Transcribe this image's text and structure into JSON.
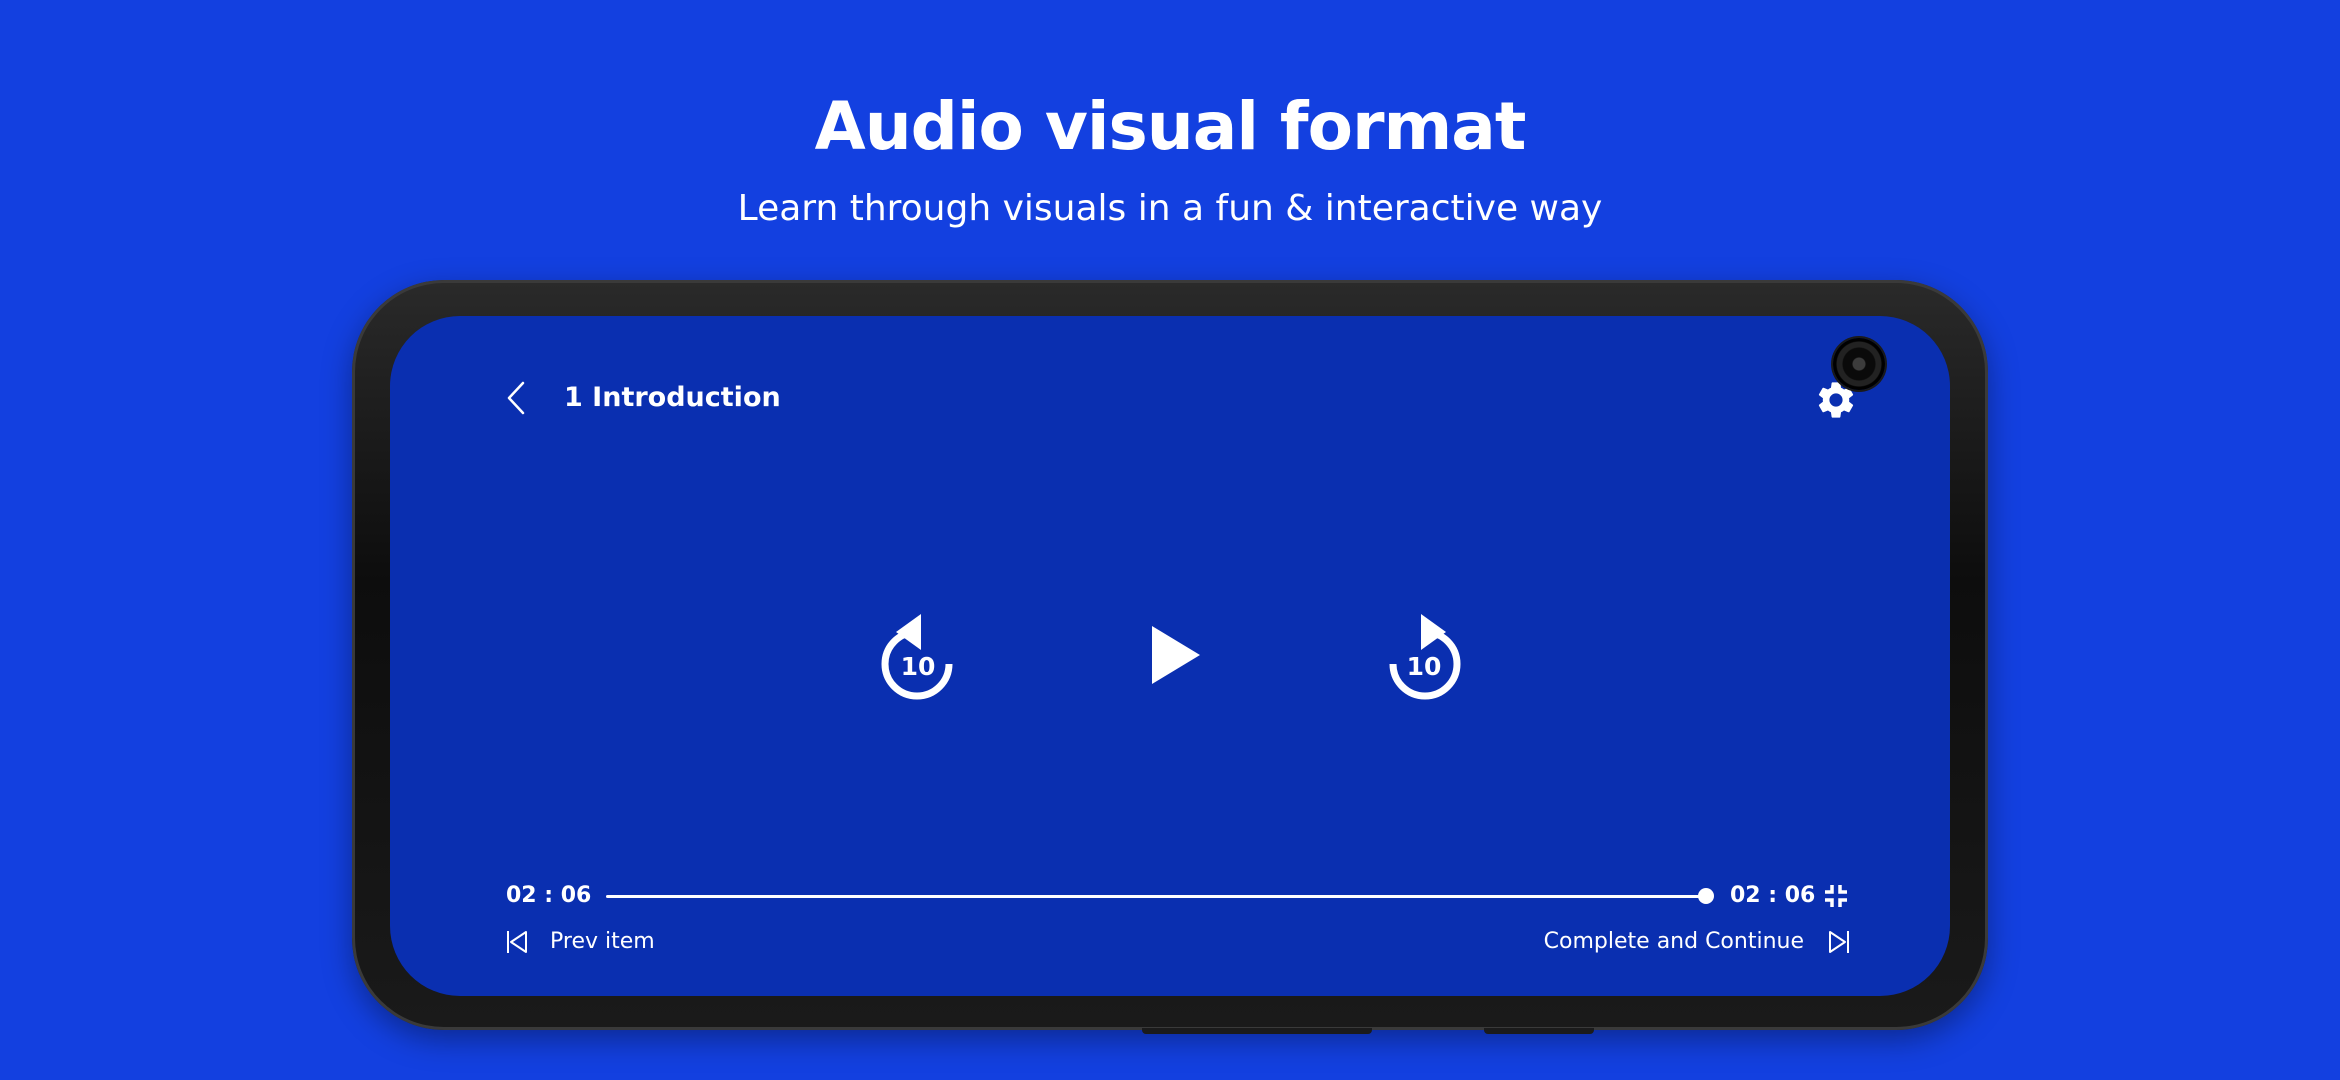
{
  "banner": {
    "title": "Audio visual format",
    "subtitle": "Learn through visuals in a fun & interactive way"
  },
  "player": {
    "lesson_title": "1 Introduction",
    "rewind_seconds": "10",
    "forward_seconds": "10",
    "elapsed_time": "02 : 06",
    "total_time": "02 : 06",
    "progress_fraction": 1.0,
    "prev_label": "Prev item",
    "next_label": "Complete and Continue"
  },
  "icons": {
    "back": "chevron-left-icon",
    "settings": "gear-icon",
    "rewind": "replay-10-icon",
    "play": "play-icon",
    "forward": "forward-10-icon",
    "exit_fullscreen": "exit-fullscreen-icon",
    "prev": "skip-previous-icon",
    "next": "skip-next-icon"
  },
  "colors": {
    "page_background": "#1340E0",
    "screen_background": "#0A2FB0",
    "foreground": "#FFFFFF",
    "device_frame": "#111111"
  }
}
